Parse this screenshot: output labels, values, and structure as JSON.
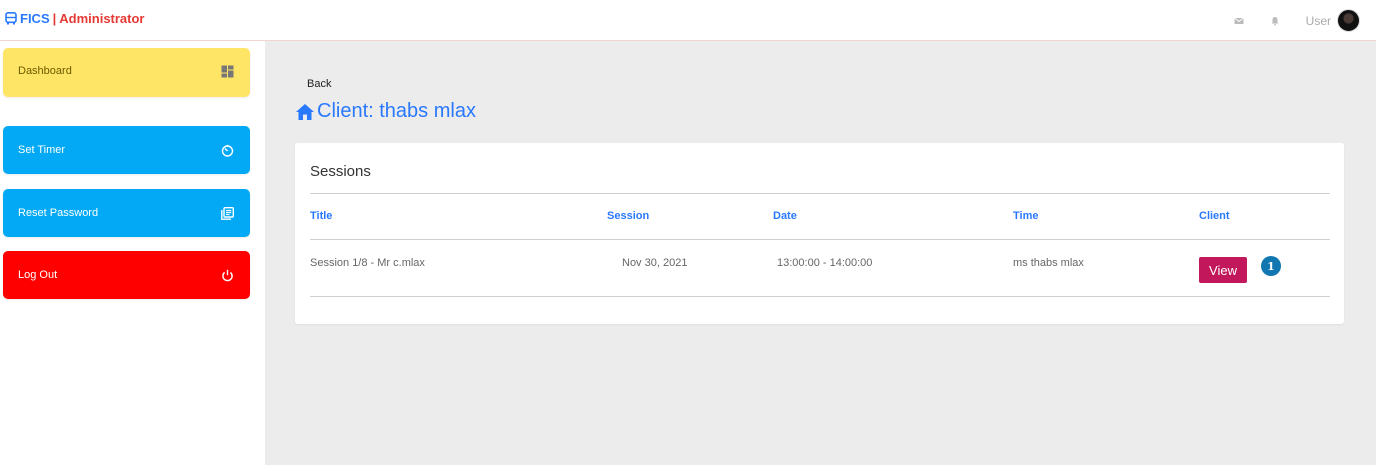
{
  "header": {
    "brand_name": "FICS",
    "brand_separator": "|",
    "brand_role": "Administrator",
    "user_label": "User",
    "icons": [
      "bus-icon",
      "envelope-icon",
      "bell-icon",
      "avatar"
    ],
    "colors": {
      "brand_blue": "#2979ff",
      "brand_red": "#e53935"
    }
  },
  "sidebar": {
    "items": [
      {
        "label": "Dashboard",
        "icon": "dashboard-icon",
        "color": "#ffe566"
      },
      {
        "label": "Set Timer",
        "icon": "timer-icon",
        "color": "#03a9f4"
      },
      {
        "label": "Reset Password",
        "icon": "library-books-icon",
        "color": "#03a9f4"
      },
      {
        "label": "Log Out",
        "icon": "power-icon",
        "color": "#ff0000"
      }
    ]
  },
  "main": {
    "back_label": "Back",
    "title": "Client: thabs mlax",
    "title_icon": "home-icon",
    "sessions": {
      "heading": "Sessions",
      "columns": [
        "Title",
        "Session",
        "Date",
        "Time",
        "Client"
      ],
      "rows": [
        {
          "title": "Session 1/8 - Mr c.mlax",
          "session": "Nov 30, 2021",
          "date": "13:00:00 - 14:00:00",
          "time": "ms thabs mlax",
          "action_label": "View",
          "badge": "1"
        }
      ]
    }
  }
}
